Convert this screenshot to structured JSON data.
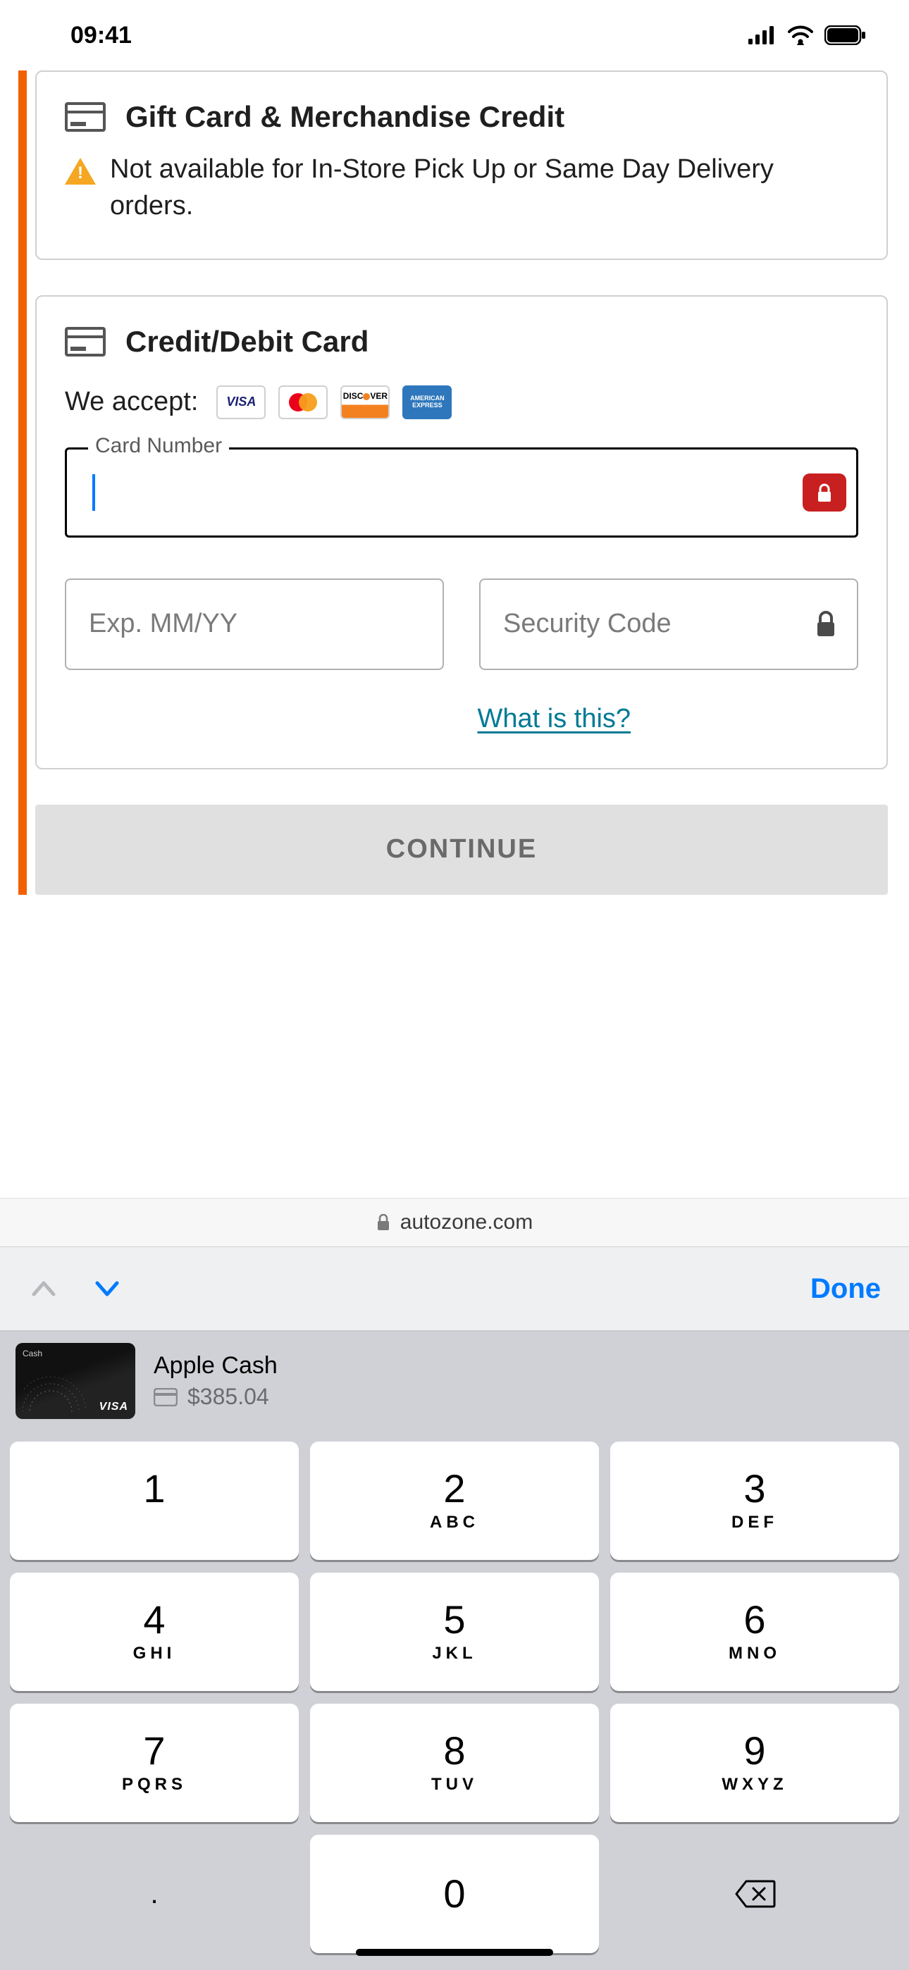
{
  "status": {
    "time": "09:41"
  },
  "giftcard": {
    "title": "Gift Card & Merchandise Credit",
    "warning": "Not available for In-Store Pick Up or Same Day Delivery orders."
  },
  "creditcard": {
    "title": "Credit/Debit Card",
    "accept_label": "We accept:",
    "brands": [
      "VISA",
      "MASTERCARD",
      "DISCOVER",
      "AMEX"
    ],
    "cardnum_label": "Card Number",
    "cardnum_value": "",
    "exp_placeholder": "Exp. MM/YY",
    "cvv_placeholder": "Security Code",
    "help_link": "What is this?"
  },
  "continue_label": "CONTINUE",
  "address_bar": {
    "domain": "autozone.com"
  },
  "nav": {
    "done": "Done"
  },
  "autofill": {
    "name": "Apple Cash",
    "amount": "$385.04"
  },
  "keys": {
    "k1": "1",
    "k2": "2",
    "k2l": "ABC",
    "k3": "3",
    "k3l": "DEF",
    "k4": "4",
    "k4l": "GHI",
    "k5": "5",
    "k5l": "JKL",
    "k6": "6",
    "k6l": "MNO",
    "k7": "7",
    "k7l": "PQRS",
    "k8": "8",
    "k8l": "TUV",
    "k9": "9",
    "k9l": "WXYZ",
    "k0": "0"
  }
}
